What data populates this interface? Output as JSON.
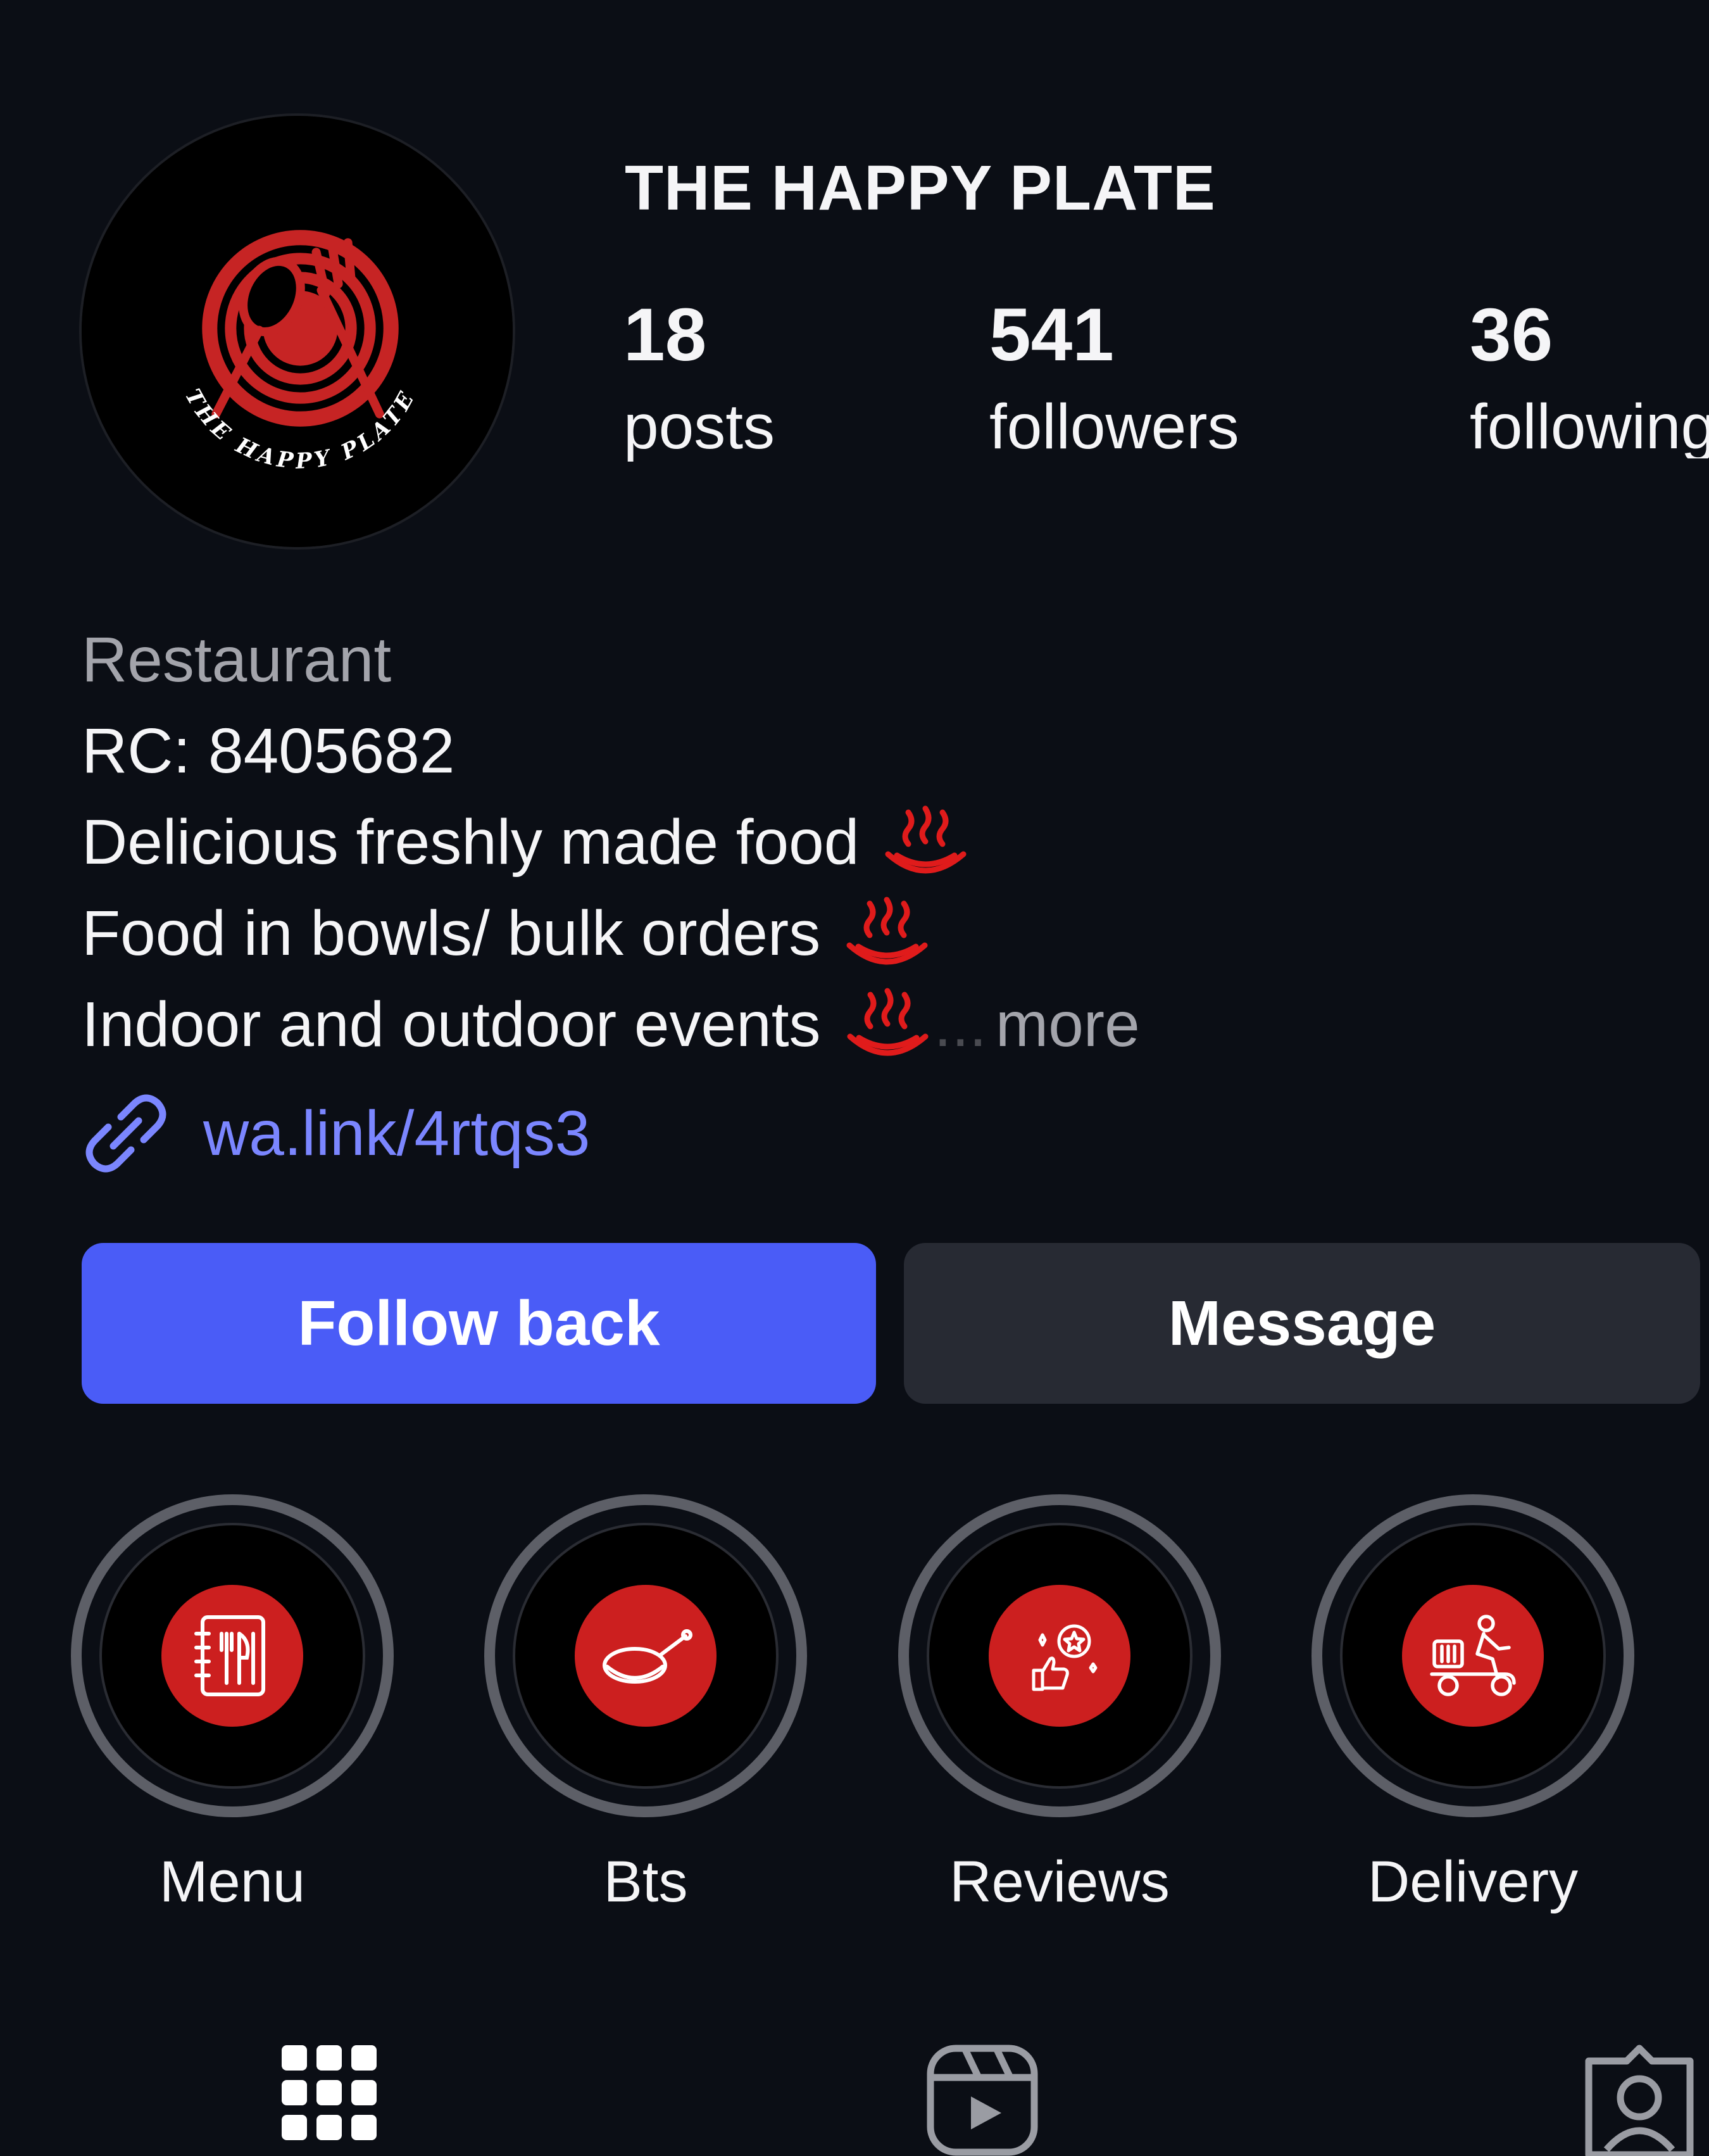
{
  "profile": {
    "name": "THE HAPPY PLATE",
    "avatar_icon": "restaurant-logo",
    "logo_text": "THE HAPPY PLATE",
    "logo_color": "#c62424"
  },
  "stats": {
    "posts": {
      "count": "18",
      "label": "posts"
    },
    "followers": {
      "count": "541",
      "label": "followers"
    },
    "following": {
      "count": "36",
      "label": "following"
    }
  },
  "bio": {
    "category": "Restaurant",
    "lines": [
      "RC: 8405682",
      "Delicious freshly made food",
      "Food in bowls/ bulk orders",
      "Indoor and outdoor events"
    ],
    "emoji_icon": "hot-springs-icon",
    "ellipsis": "...",
    "more_label": "more"
  },
  "link": {
    "icon": "link-icon",
    "text": "wa.link/4rtqs3"
  },
  "buttons": {
    "follow_back": "Follow back",
    "message": "Message"
  },
  "highlights": [
    {
      "label": "Menu",
      "icon": "menu-book-icon"
    },
    {
      "label": "Bts",
      "icon": "frying-pan-icon"
    },
    {
      "label": "Reviews",
      "icon": "reviews-icon"
    },
    {
      "label": "Delivery",
      "icon": "delivery-scooter-icon"
    }
  ],
  "tabs": [
    {
      "name": "posts-grid",
      "icon": "grid-icon"
    },
    {
      "name": "reels",
      "icon": "reels-icon"
    },
    {
      "name": "tagged",
      "icon": "tagged-icon"
    }
  ],
  "colors": {
    "background": "#0b0e15",
    "accent": "#4a5cf7",
    "link": "#7b86ff",
    "brand_red": "#cc1f1f",
    "secondary_button": "#272a33"
  }
}
